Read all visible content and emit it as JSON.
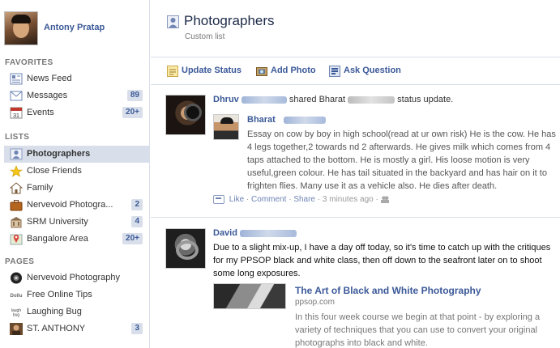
{
  "profile": {
    "name": "Antony Pratap"
  },
  "sidebar": {
    "favorites_heading": "FAVORITES",
    "favorites": [
      {
        "label": "News Feed",
        "icon": "news-feed-icon"
      },
      {
        "label": "Messages",
        "icon": "messages-icon",
        "count": "89"
      },
      {
        "label": "Events",
        "icon": "events-icon",
        "count": "20+"
      }
    ],
    "lists_heading": "LISTS",
    "lists": [
      {
        "label": "Photographers",
        "icon": "person-list-icon",
        "selected": true
      },
      {
        "label": "Close Friends",
        "icon": "star-icon"
      },
      {
        "label": "Family",
        "icon": "house-icon"
      },
      {
        "label": "Nervevoid Photogra...",
        "icon": "briefcase-icon",
        "count": "2"
      },
      {
        "label": "SRM University",
        "icon": "school-icon",
        "count": "4"
      },
      {
        "label": "Bangalore Area",
        "icon": "map-pin-icon",
        "count": "20+"
      }
    ],
    "pages_heading": "PAGES",
    "pages": [
      {
        "label": "Nervevoid Photography",
        "icon": "page-avatar-icon"
      },
      {
        "label": "Free Online Tips",
        "icon": "page-logo-icon"
      },
      {
        "label": "Laughing Bug",
        "icon": "page-logo-icon"
      },
      {
        "label": "ST. ANTHONY",
        "icon": "page-avatar-icon",
        "count": "3"
      }
    ]
  },
  "header": {
    "title": "Photographers",
    "subtitle": "Custom list"
  },
  "composer": {
    "update_status": "Update Status",
    "add_photo": "Add Photo",
    "ask_question": "Ask Question"
  },
  "feed": [
    {
      "actor": "Dhruv",
      "action_pre": "shared Bharat",
      "action_post": "status update.",
      "shared_actor": "Bharat",
      "text": "Essay on cow by boy in high school(read at ur own risk) He is the cow. He has 4 legs together,2 towards nd 2 afterwards. He gives milk which comes from 4 taps attached to the bottom. He is mostly a girl. His loose motion is very useful,green colour. He has tail situated in the backyard and has hair on it to frighten flies. Many use it as a vehicle also. He dies after death.",
      "like": "Like",
      "comment": "Comment",
      "share": "Share",
      "time": "3 minutes ago",
      "sep": "·"
    },
    {
      "actor": "David",
      "text": "Due to a slight mix-up, I have a day off today, so it's time to catch up with the critiques for my PPSOP black and white class, then off down to the seafront later on to shoot some long exposures.",
      "link_title": "The Art of Black and White Photography",
      "link_url": "ppsop.com",
      "link_desc": "In this four week course we begin at that point - by exploring a variety of techniques that you can use to convert your original photographs into black and white."
    }
  ],
  "colors": {
    "link": "#3b5998",
    "selected_bg": "#d8dfea",
    "muted": "#999999"
  }
}
